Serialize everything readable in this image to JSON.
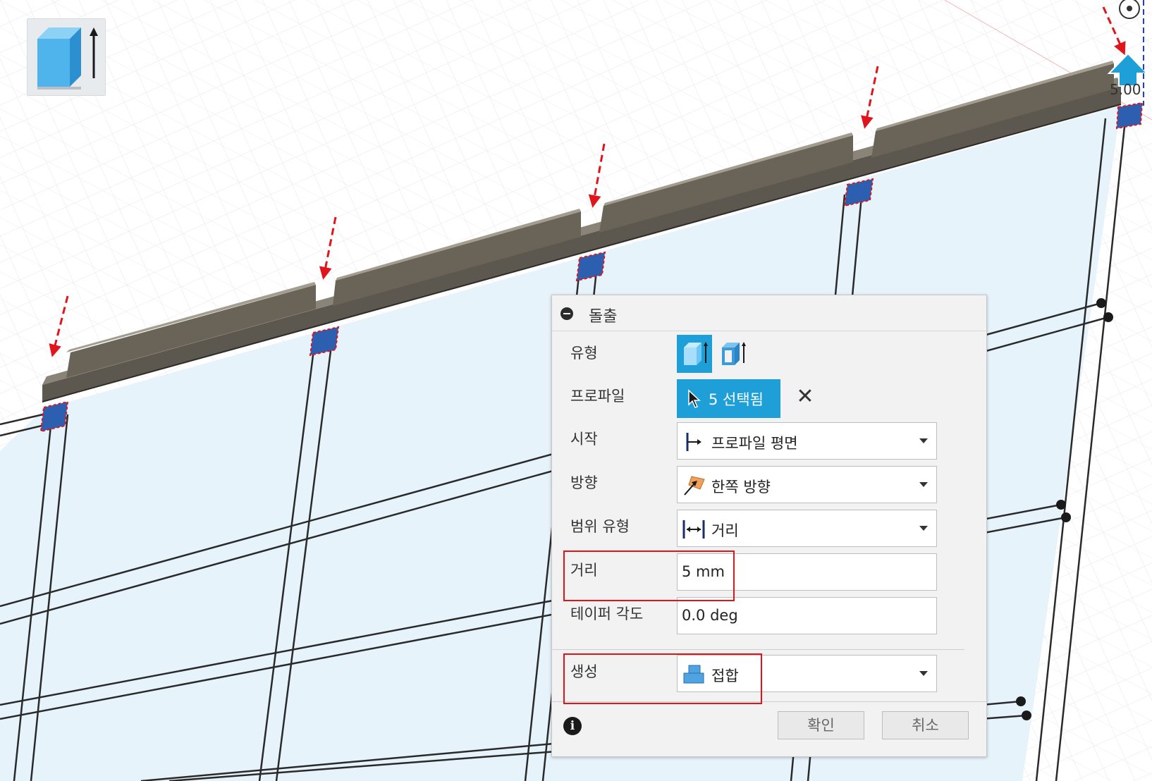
{
  "viewport": {
    "dimension_label": "5.00"
  },
  "panel": {
    "title": "돌출",
    "labels": {
      "type": "유형",
      "profile": "프로파일",
      "start": "시작",
      "direction": "방향",
      "extent_type": "범위 유형",
      "distance": "거리",
      "taper": "테이퍼 각도",
      "operation": "생성"
    },
    "profile_selection": "5 선택됨",
    "clear_symbol": "✕",
    "start_value": "프로파일 평면",
    "direction_value": "한쪽 방향",
    "extent_value": "거리",
    "distance_value": "5 mm",
    "taper_value": "0.0 deg",
    "operation_value": "접합",
    "info_symbol": "i",
    "ok_label": "확인",
    "cancel_label": "취소"
  },
  "colors": {
    "accent": "#1e9fd8",
    "highlight": "#e0141b",
    "arrow": "#e0141b",
    "profile_face": "#2d5fb0",
    "sketch_fill": "#e6f3fb"
  },
  "icons": [
    "extrude-tool-icon",
    "solid-type-icon",
    "thin-type-icon",
    "cursor-icon",
    "clear-icon",
    "start-plane-icon",
    "one-side-direction-icon",
    "distance-extent-icon",
    "join-operation-icon",
    "info-icon",
    "manipulator-arrow-icon",
    "view-cube-icon"
  ]
}
